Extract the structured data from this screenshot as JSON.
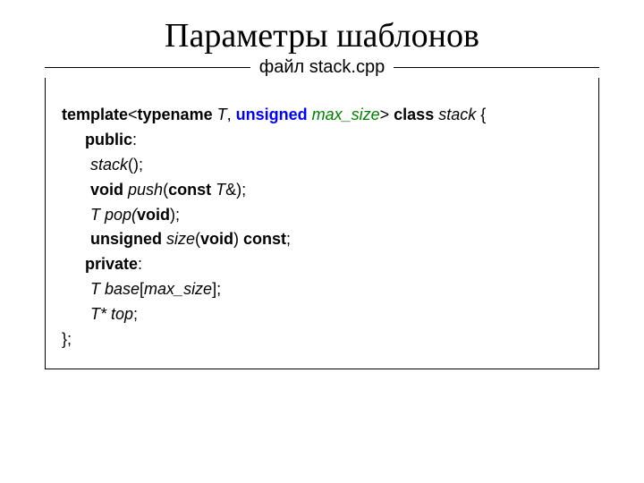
{
  "title": "Параметры шаблонов",
  "caption": "файл stack.cpp",
  "code": {
    "l1": {
      "a": "template",
      "b": "<",
      "c": "typename",
      "d": " T",
      "e": ", ",
      "f": "unsigned",
      "g": " max_size",
      "h": "> ",
      "i": "class",
      "j": " stack",
      "k": " {"
    },
    "l2": {
      "a": "public",
      "b": ":"
    },
    "l3": {
      "a": "stack",
      "b": "();"
    },
    "l4": {
      "a": "void",
      "b": " push",
      "c": "(",
      "d": "const",
      "e": " T",
      "f": "&);"
    },
    "l5": {
      "a": "T pop(",
      "b": "void",
      "c": ");"
    },
    "l6": {
      "a": "unsigned",
      "b": " size",
      "c": "(",
      "d": "void",
      "e": ") ",
      "f": "const",
      "g": ";"
    },
    "l7": {
      "a": "private",
      "b": ":"
    },
    "l8": {
      "a": "T  base",
      "b": "[",
      "c": "max_size",
      "d": "];"
    },
    "l9": {
      "a": "T* top",
      "b": ";"
    },
    "l10": "};"
  }
}
